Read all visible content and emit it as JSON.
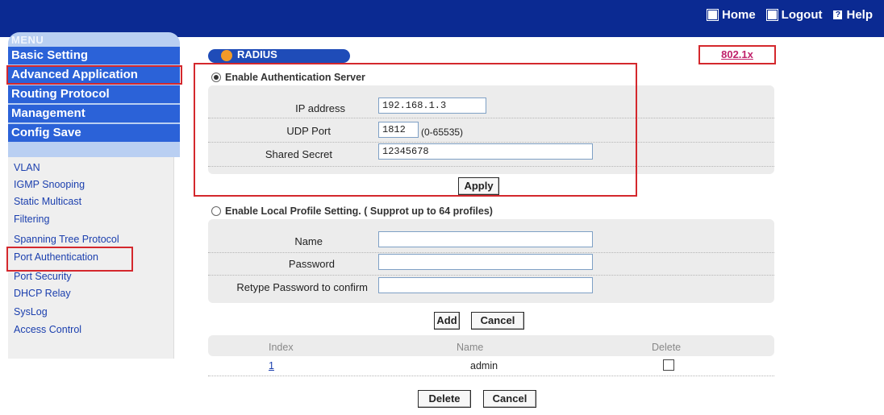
{
  "toplinks": {
    "home": "Home",
    "logout": "Logout",
    "help": "Help"
  },
  "menu": {
    "title": "MENU",
    "items": [
      "Basic Setting",
      "Advanced Application",
      "Routing Protocol",
      "Management",
      "Config Save"
    ],
    "sub_items": [
      "VLAN",
      "IGMP Snooping",
      "Static Multicast",
      "Filtering",
      "Spanning Tree Protocol",
      "Port Authentication",
      "Port Security",
      "DHCP Relay",
      "SysLog",
      "Access Control"
    ]
  },
  "section": {
    "title": "RADIUS",
    "tag": "802.1x"
  },
  "auth_server": {
    "label": "Enable Authentication Server",
    "selected": true,
    "ip_label": "IP address",
    "ip_value": "192.168.1.3",
    "udp_label": "UDP Port",
    "udp_value": "1812",
    "udp_range": "(0-65535)",
    "secret_label": "Shared Secret",
    "secret_value": "12345678",
    "apply_label": "Apply"
  },
  "local_profile": {
    "label": "Enable Local Profile Setting. ( Supprot up to  64  profiles)",
    "selected": false,
    "name_label": "Name",
    "password_label": "Password",
    "retype_label": "Retype Password to confirm",
    "name_value": "",
    "password_value": "",
    "retype_value": "",
    "add_label": "Add",
    "cancel_label": "Cancel"
  },
  "profile_table": {
    "headers": [
      "Index",
      "Name",
      "Delete"
    ],
    "rows": [
      {
        "index": "1",
        "name": "admin",
        "delete_checked": false
      }
    ]
  },
  "bottom": {
    "delete_label": "Delete",
    "cancel_label": "Cancel"
  },
  "colors": {
    "header_bg": "#0b2a92",
    "menu_item_bg": "#2b62d8",
    "highlight_red": "#d4282d",
    "tag_text": "#c0216b"
  }
}
